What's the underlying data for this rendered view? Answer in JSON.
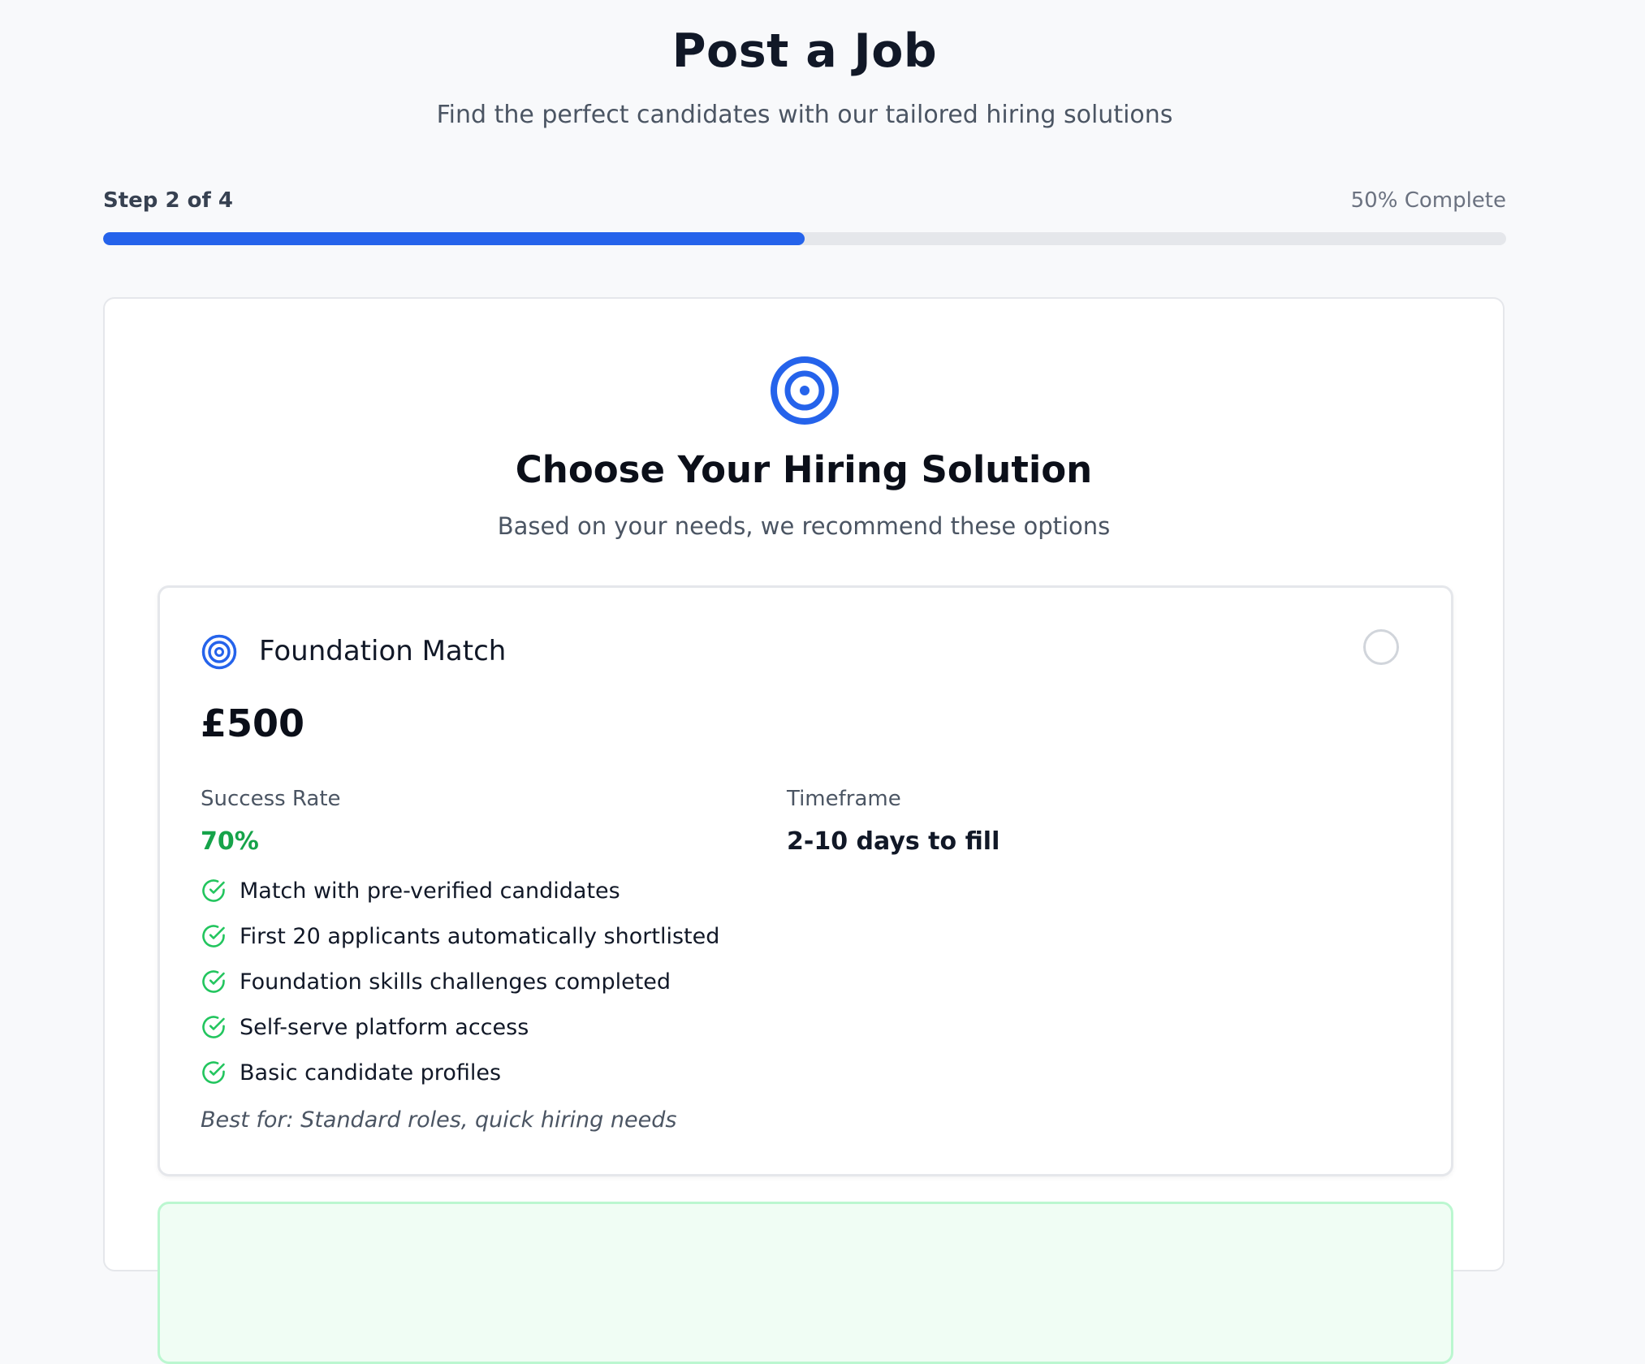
{
  "header": {
    "title": "Post a Job",
    "subtitle": "Find the perfect candidates with our tailored hiring solutions"
  },
  "progress": {
    "step_label": "Step 2 of 4",
    "complete_label": "50% Complete",
    "percent": 50,
    "fill_color": "#2563eb"
  },
  "section": {
    "icon": "target-icon",
    "title": "Choose Your Hiring Solution",
    "subtitle": "Based on your needs, we recommend these options"
  },
  "options": [
    {
      "icon": "target-icon",
      "name": "Foundation Match",
      "price": "£500",
      "selected": false,
      "success_rate_label": "Success Rate",
      "success_rate_value": "70%",
      "timeframe_label": "Timeframe",
      "timeframe_value": "2-10 days to fill",
      "features": [
        "Match with pre-verified candidates",
        "First 20 applicants automatically shortlisted",
        "Foundation skills challenges completed",
        "Self-serve platform access",
        "Basic candidate profiles"
      ],
      "best_for": "Best for: Standard roles, quick hiring needs"
    }
  ],
  "colors": {
    "accent": "#2563eb",
    "success": "#16a34a",
    "next_card_border": "#bbf7d0"
  }
}
